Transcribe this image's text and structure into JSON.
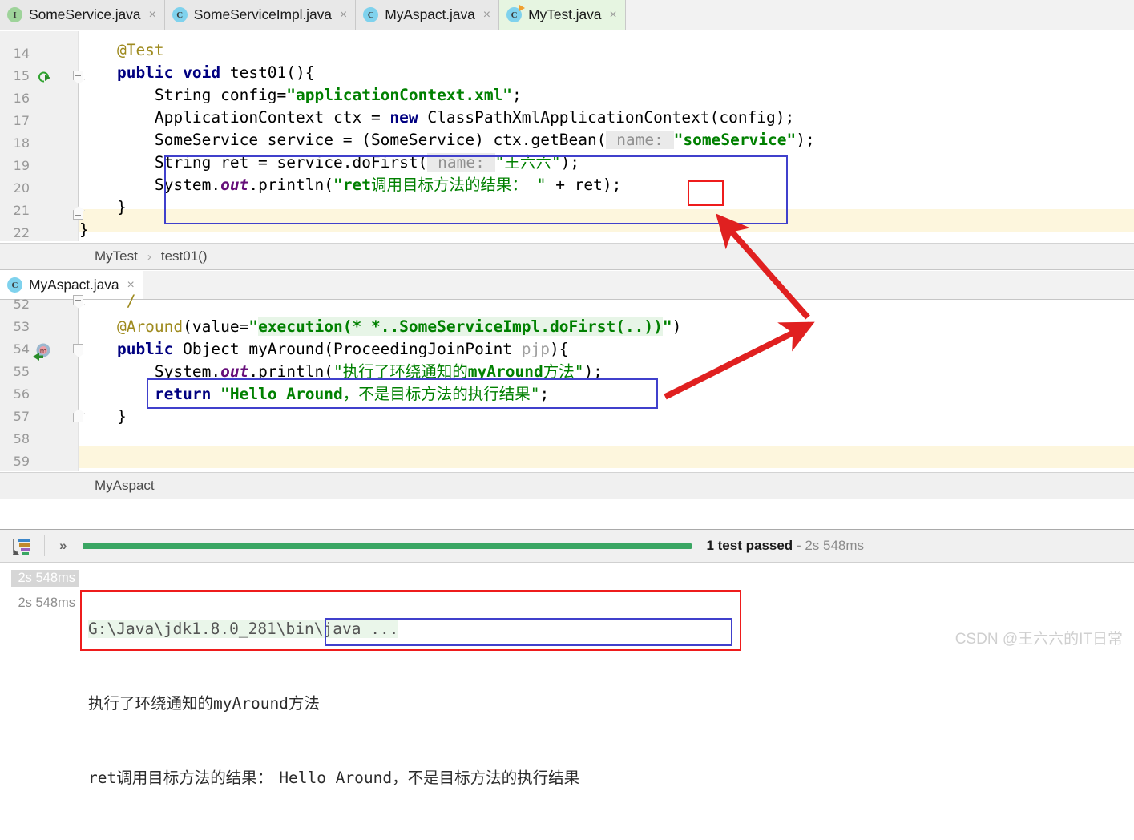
{
  "window": {
    "watermark": "CSDN @王六六的IT日常"
  },
  "tabs": [
    {
      "label": "SomeService.java",
      "icon": "interface-icon",
      "icon_letter": "I",
      "active": false,
      "close": "×"
    },
    {
      "label": "SomeServiceImpl.java",
      "icon": "class-icon",
      "icon_letter": "C",
      "active": false,
      "close": "×"
    },
    {
      "label": "MyAspact.java",
      "icon": "class-icon",
      "icon_letter": "C",
      "active": false,
      "close": "×"
    },
    {
      "label": "MyTest.java",
      "icon": "class-runnable-icon",
      "icon_letter": "C",
      "active": true,
      "close": "×"
    }
  ],
  "editor_top": {
    "line_numbers": [
      "14",
      "15",
      "16",
      "17",
      "18",
      "19",
      "20",
      "21",
      "22"
    ],
    "highlighted_line": "20",
    "run_gutter_line": "15",
    "lines": [
      "    @Test",
      "    public void test01(){",
      "        String config=\"applicationContext.xml\";",
      "        ApplicationContext ctx = new ClassPathXmlApplicationContext(config);",
      "        SomeService service = (SomeService) ctx.getBean( name: \"someService\");",
      "        String ret = service.doFirst( name: \"王六六\");",
      "        System.out.println(\"ret调用目标方法的结果： \" + ret);",
      "    }",
      "}"
    ],
    "breadcrumb": {
      "class": "MyTest",
      "separator": "›",
      "method": "test01()"
    }
  },
  "editor_bottom": {
    "tab": {
      "label": "MyAspact.java",
      "icon_letter": "C",
      "close": "×"
    },
    "line_numbers": [
      "52",
      "53",
      "54",
      "55",
      "56",
      "57",
      "58",
      "59"
    ],
    "highlighted_line": "59",
    "advice_gutter_line": "54",
    "lines": [
      "     /",
      "    @Around(value=\"execution(* *..SomeServiceImpl.doFirst(..))\")",
      "    public Object myAround(ProceedingJoinPoint pjp){",
      "        System.out.println(\"执行了环绕通知的myAround方法\");",
      "        return \"Hello Around，不是目标方法的执行结果\";",
      "    }",
      "",
      ""
    ],
    "breadcrumb": {
      "class": "MyAspact"
    }
  },
  "run_panel": {
    "toolbar_icon": "test-results-list-icon",
    "expand_icon": "chevron-double-right-icon",
    "status_text": "1 test passed",
    "status_dash": "-",
    "status_duration": "2s 548ms",
    "progress_color": "#3aa663"
  },
  "console": {
    "timestamps": [
      "2s 548ms",
      "2s 548ms"
    ],
    "lines": [
      "G:\\Java\\jdk1.8.0_281\\bin\\java ...",
      "执行了环绕通知的myAround方法",
      "ret调用目标方法的结果：",
      "Hello Around，不是目标方法的执行结果"
    ]
  },
  "annotations": {
    "blue_box_color": "#4040cc",
    "red_box_color": "#ee1c1c",
    "arrow_color": "#e02020",
    "arrow_count": 2
  }
}
